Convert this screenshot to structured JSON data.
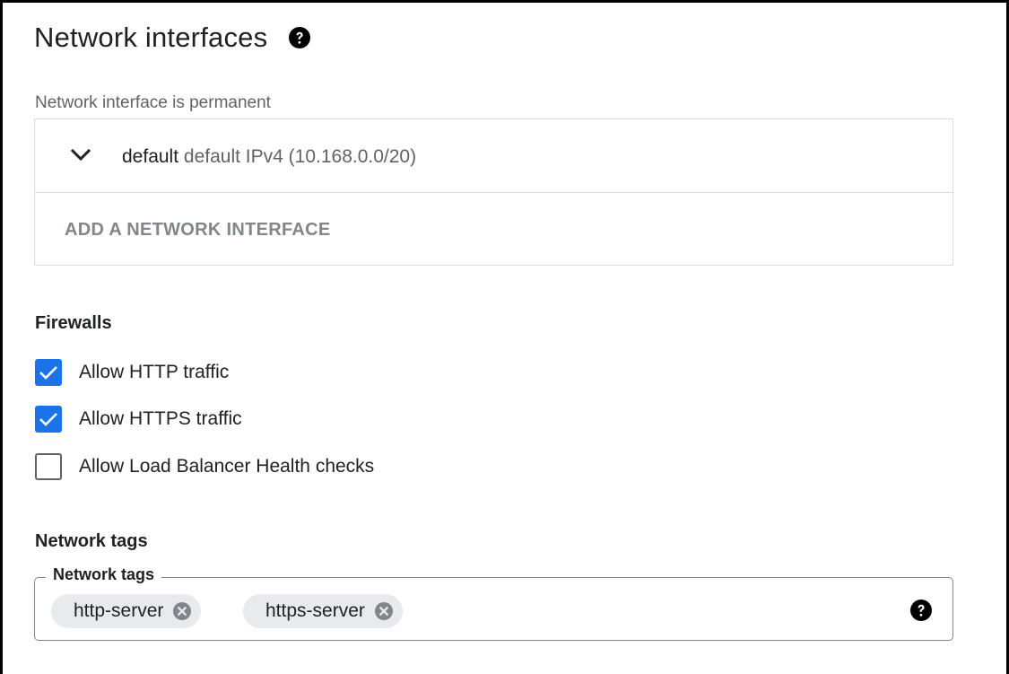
{
  "section": {
    "title": "Network interfaces",
    "help_icon": "help-circle-icon"
  },
  "network_interface": {
    "permanent_note": "Network interface is permanent",
    "expand_icon": "chevron-down-icon",
    "name": "default",
    "detail": "default IPv4 (10.168.0.0/20)",
    "add_label": "ADD A NETWORK INTERFACE"
  },
  "firewalls": {
    "label": "Firewalls",
    "options": [
      {
        "label": "Allow HTTP traffic",
        "checked": true
      },
      {
        "label": "Allow HTTPS traffic",
        "checked": true
      },
      {
        "label": "Allow Load Balancer Health checks",
        "checked": false
      }
    ]
  },
  "network_tags": {
    "label": "Network tags",
    "field_label": "Network tags",
    "chips": [
      {
        "label": "http-server",
        "remove_icon": "close-circle-icon"
      },
      {
        "label": "https-server",
        "remove_icon": "close-circle-icon"
      }
    ],
    "help_icon": "help-circle-icon"
  },
  "colors": {
    "accent": "#1a73e8",
    "text_primary": "#202124",
    "text_secondary": "#5f6368",
    "chip_bg": "#e8eaed",
    "border": "#dadce0"
  }
}
